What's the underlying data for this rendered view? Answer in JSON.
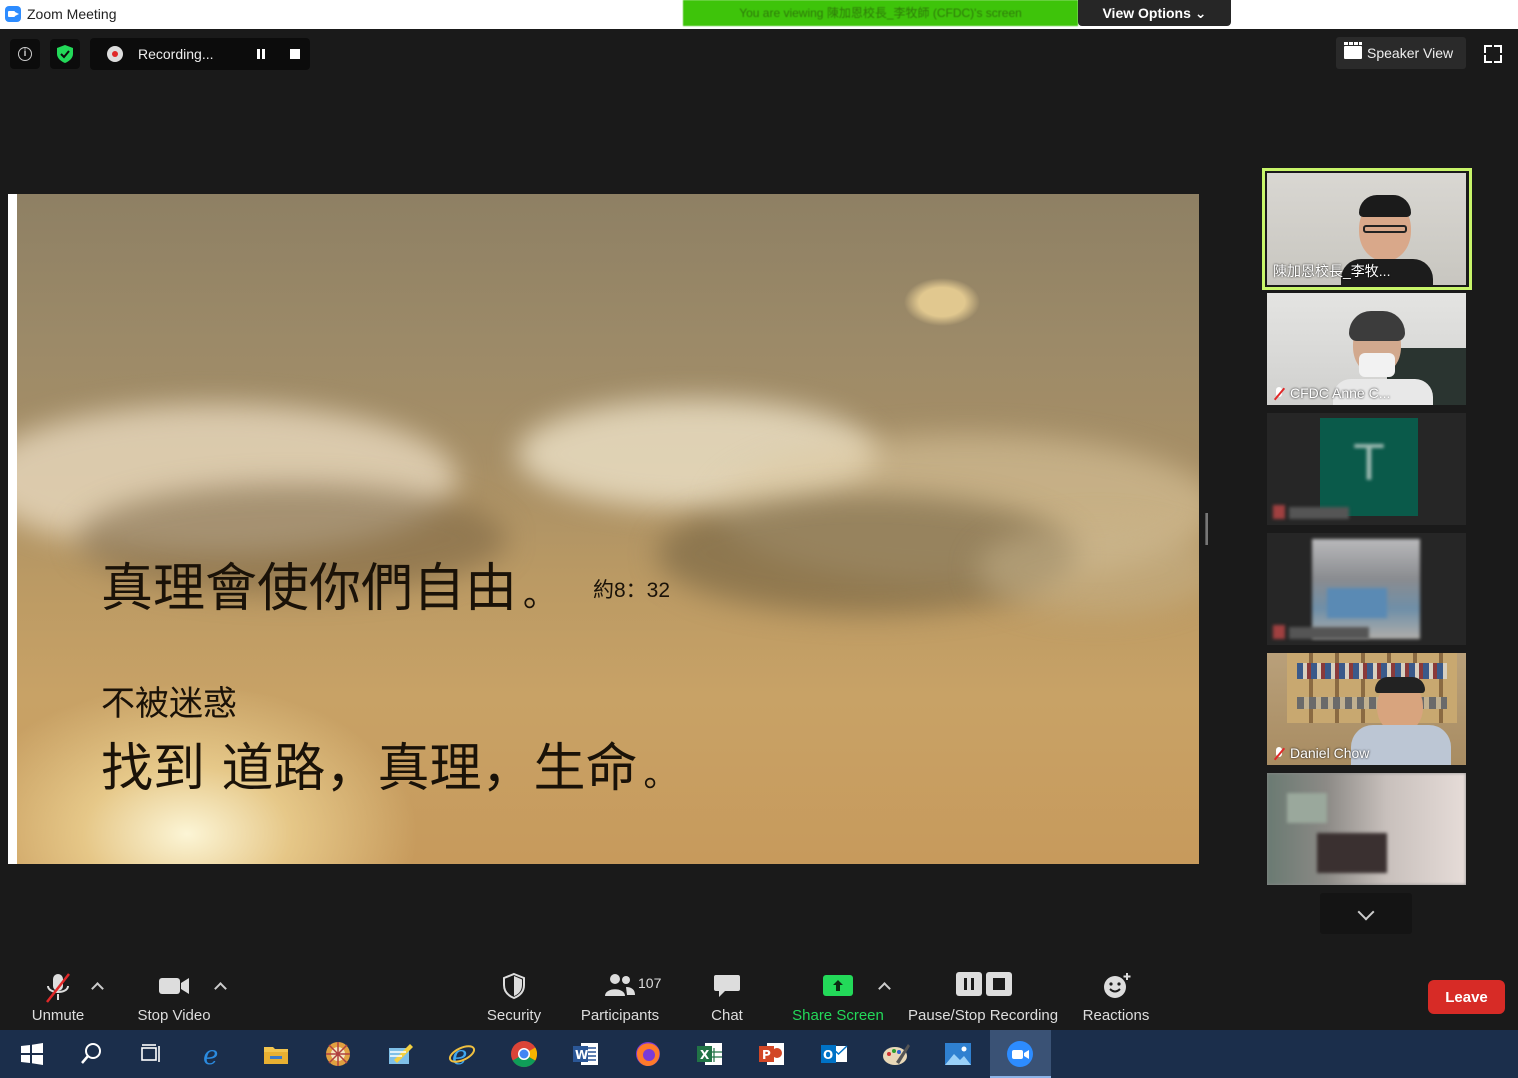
{
  "window": {
    "title": "Zoom Meeting"
  },
  "share_banner": {
    "text": "You are viewing 陳加恩校長_李牧師 (CFDC)'s screen"
  },
  "view_options": {
    "label": "View Options ⌄"
  },
  "recording": {
    "label": "Recording..."
  },
  "speaker_view": {
    "label": "Speaker View"
  },
  "slide": {
    "line1": "真理會使你們自由",
    "period1": "。",
    "reference": "約8：32",
    "line2": "不被迷惑",
    "line3": "找到 道路，真理，生命",
    "period3": "。"
  },
  "participants": [
    {
      "name": "陳加恩校長_李牧...",
      "muted": false,
      "active": true
    },
    {
      "name": "CFDC Anne C...",
      "muted": true
    },
    {
      "name": "",
      "muted": true,
      "avatar_letter": "T"
    },
    {
      "name": "",
      "muted": true
    },
    {
      "name": "Daniel Chow",
      "muted": true
    },
    {
      "name": "",
      "muted": false
    }
  ],
  "controls": {
    "unmute": "Unmute",
    "stop_video": "Stop Video",
    "security": "Security",
    "participants": "Participants",
    "participants_count": "107",
    "chat": "Chat",
    "share_screen": "Share Screen",
    "pause_stop_recording": "Pause/Stop Recording",
    "reactions": "Reactions",
    "leave": "Leave"
  },
  "colors": {
    "accent_green": "#23d959",
    "active_border": "#c8f56a",
    "leave_red": "#d72b26",
    "zoom_blue": "#2d8cff"
  },
  "taskbar": {
    "icons": [
      "windows-start-icon",
      "search-icon",
      "task-view-icon",
      "edge-icon",
      "file-explorer-icon",
      "media-icon",
      "notes-icon",
      "internet-explorer-icon",
      "chrome-icon",
      "word-icon",
      "firefox-icon",
      "excel-icon",
      "powerpoint-icon",
      "outlook-icon",
      "paint-icon",
      "photos-icon",
      "zoom-icon"
    ]
  }
}
